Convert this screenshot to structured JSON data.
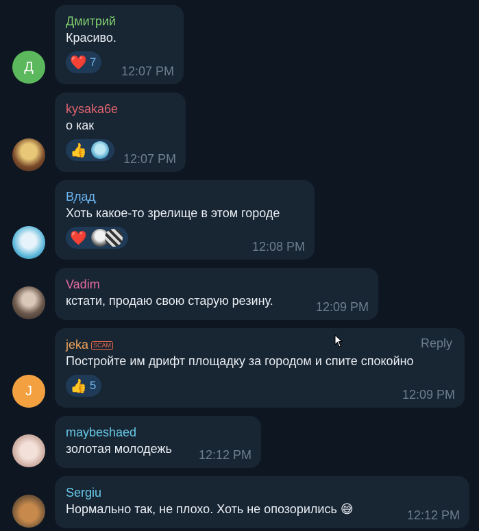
{
  "colors": {
    "background": "#0e1621",
    "bubble": "#182533",
    "time": "#6d7f8f",
    "reaction_bg": "#1f3a56",
    "reaction_count": "#74b8f0"
  },
  "messages": [
    {
      "author": "Дмитрий",
      "author_color": "#7fce6f",
      "avatar_letter": "Д",
      "avatar_color": "#5cb85c",
      "text": "Красиво.",
      "time": "12:07 PM",
      "reactions": [
        {
          "emoji": "❤️",
          "icon": "heart-icon",
          "count": "7"
        }
      ]
    },
    {
      "author": "kysaka6e",
      "author_color": "#e0646f",
      "text": "о как",
      "time": "12:07 PM",
      "reactions": [
        {
          "emoji": "👍",
          "icon": "thumbs-up-icon",
          "count": ""
        }
      ]
    },
    {
      "author": "В͙л͙а͙д͙",
      "author_color": "#6cb6f1",
      "text": "Хоть какое-то зрелище в этом городе",
      "time": "12:08 PM",
      "reactions": [
        {
          "emoji": "❤️",
          "icon": "heart-icon",
          "count": ""
        }
      ]
    },
    {
      "author": "Vadim",
      "author_color": "#e56aa0",
      "text": "кстати, продаю свою старую резину.",
      "time": "12:09 PM"
    },
    {
      "author": "jeka",
      "author_color": "#f0a55a",
      "badge": "SCAM",
      "reply_label": "Reply",
      "avatar_letter": "J",
      "avatar_color": "#f2a040",
      "text": "Постройте им дрифт площадку за городом и спите спокойно",
      "time": "12:09 PM",
      "reactions": [
        {
          "emoji": "👍",
          "icon": "thumbs-up-icon",
          "count": "5"
        }
      ]
    },
    {
      "author": "maybeshaed",
      "author_color": "#67c8e8",
      "text": "золотая молодежь",
      "time": "12:12 PM"
    },
    {
      "author": "Sergiu",
      "author_color": "#67c8e8",
      "text": "Нормально так, не плохо. Хоть не опозорились 😅",
      "time": "12:12 PM"
    }
  ]
}
